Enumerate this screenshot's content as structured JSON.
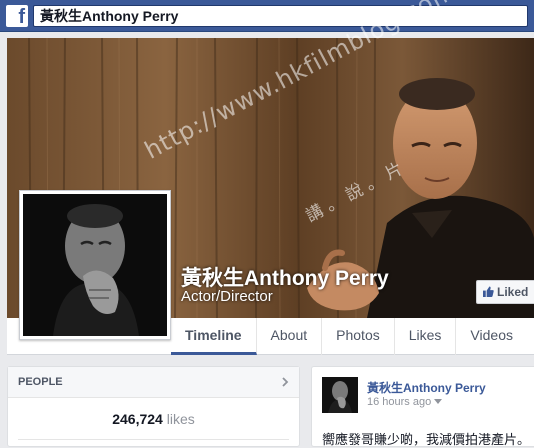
{
  "topbar": {
    "logo_glyph": "f",
    "search_value": "黃秋生Anthony Perry"
  },
  "page": {
    "name": "黃秋生Anthony Perry",
    "category": "Actor/Director",
    "liked_label": "Liked"
  },
  "watermark": {
    "text": "http://www.hkfilmblog.com/",
    "top_text": "講 。 說 。 片"
  },
  "tabs": [
    {
      "label": "Timeline"
    },
    {
      "label": "About"
    },
    {
      "label": "Photos"
    },
    {
      "label": "Likes"
    },
    {
      "label": "Videos"
    }
  ],
  "people": {
    "heading": "PEOPLE",
    "likes_count": "246,724",
    "likes_word": "likes"
  },
  "post": {
    "author": "黃秋生Anthony Perry",
    "time": "16 hours ago",
    "text": "嚮應發哥賺少啲，我減價拍港產片。"
  },
  "colors": {
    "brand_blue": "#3b5998",
    "page_bg": "#e9eaed"
  }
}
